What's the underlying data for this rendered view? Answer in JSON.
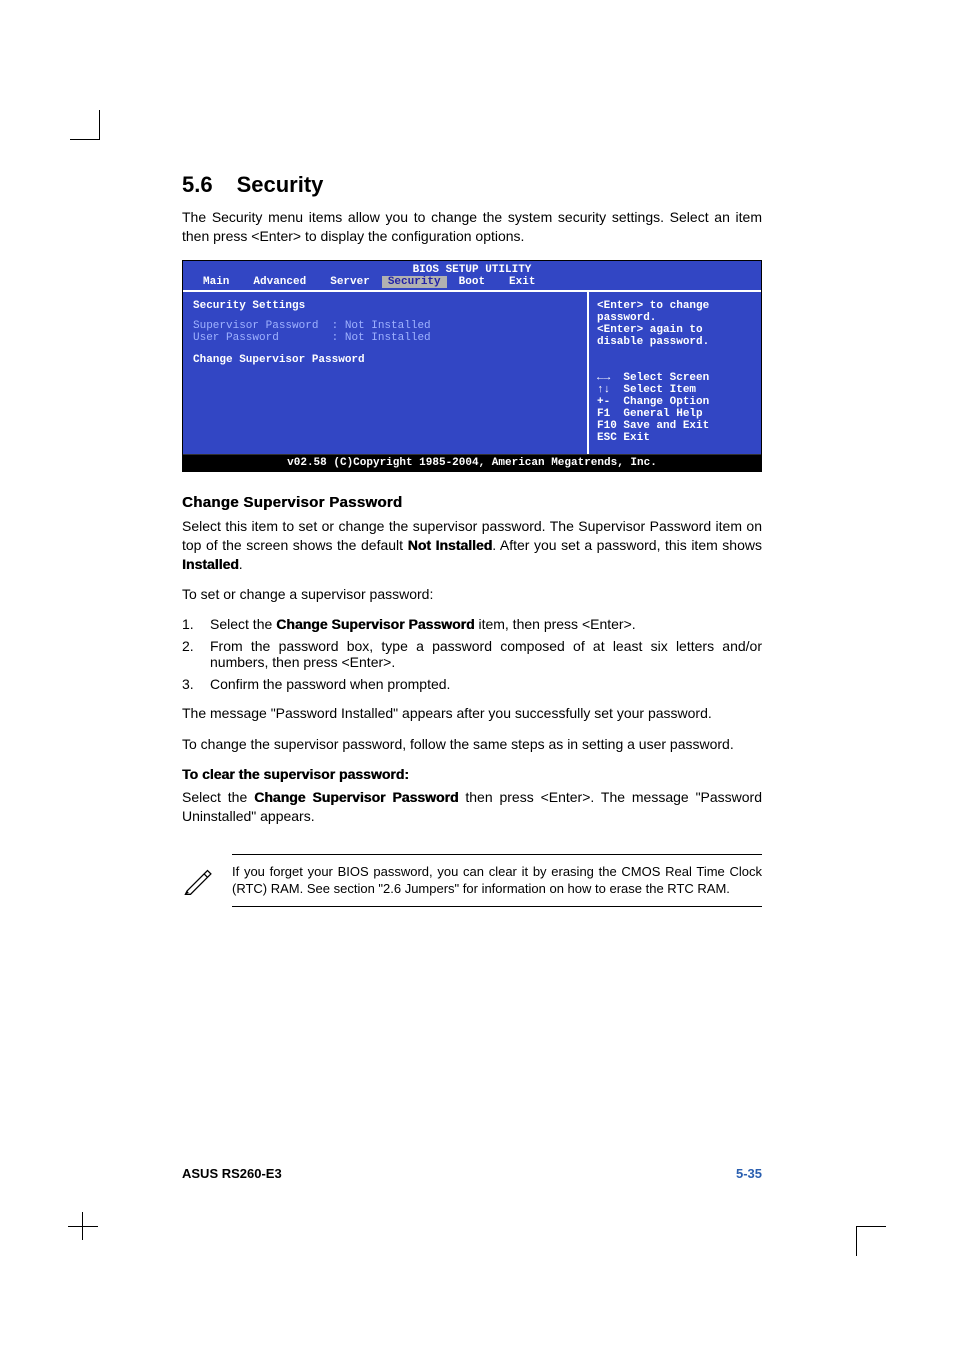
{
  "heading": {
    "number": "5.6",
    "title": "Security"
  },
  "intro": "The Security menu items allow you to change the system security settings. Select an item then press <Enter> to display the configuration options.",
  "bios": {
    "title": "BIOS SETUP UTILITY",
    "tabs": {
      "main": "Main",
      "advanced": "Advanced",
      "server": "Server",
      "security": "Security",
      "boot": "Boot",
      "exit": "Exit"
    },
    "left": {
      "heading": "Security Settings",
      "supervisor_label": "Supervisor Password",
      "supervisor_value": ": Not Installed",
      "user_label": "User Password",
      "user_value": ": Not Installed",
      "change_item": "Change Supervisor Password"
    },
    "right": {
      "help1": "<Enter> to change",
      "help2": "password.",
      "help3": "<Enter> again to",
      "help4": "disable password.",
      "k1": "←→  Select Screen",
      "k2": "↑↓  Select Item",
      "k3": "+-  Change Option",
      "k4": "F1  General Help",
      "k5": "F10 Save and Exit",
      "k6": "ESC Exit"
    },
    "footer": "v02.58 (C)Copyright 1985-2004, American Megatrends, Inc."
  },
  "sub_heading": "Change Supervisor Password",
  "para1_a": "Select this item to set or change the supervisor password. The Supervisor Password item on top of the screen shows the default ",
  "para1_b": "Not Installed",
  "para1_c": ". After you set a password, this item shows ",
  "para1_d": "Installed",
  "para1_e": ".",
  "para2": "To set or change a supervisor password:",
  "steps": {
    "s1a": "Select the ",
    "s1b": "Change Supervisor Password",
    "s1c": " item, then press <Enter>.",
    "s2": "From the password box, type a password composed of at least six letters and/or numbers, then press <Enter>.",
    "s3": "Confirm the password when prompted."
  },
  "para3": "The message \"Password Installed\" appears after you successfully set your password.",
  "para4": "To change the supervisor password, follow the same steps as in setting a user password.",
  "clear_heading": "To clear the supervisor password:",
  "clear_a": "Select the ",
  "clear_b": "Change Supervisor Password",
  "clear_c": " then press <Enter>. The message \"Password Uninstalled\" appears.",
  "note": "If you forget your BIOS password, you can clear it by erasing the CMOS Real Time Clock (RTC) RAM. See section \"2.6  Jumpers\" for information on how to erase the RTC RAM.",
  "footer": {
    "left": "ASUS RS260-E3",
    "right": "5-35"
  }
}
